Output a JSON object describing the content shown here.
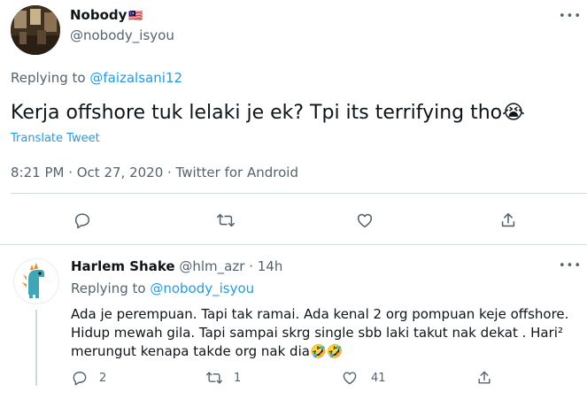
{
  "main_tweet": {
    "display_name": "Nobody",
    "flag_emoji": "🇲🇾",
    "handle": "@nobody_isyou",
    "replying_prefix": "Replying to ",
    "replying_to": "@faizalsani12",
    "text": "Kerja offshore tuk lelaki je ek? Tpi its terrifying tho",
    "emoji": "😭",
    "translate_label": "Translate Tweet",
    "meta": "8:21 PM · Oct 27, 2020 · Twitter for Android"
  },
  "reply_tweet": {
    "display_name": "Harlem Shake",
    "handle": "@hlm_azr",
    "separator": "·",
    "time": "14h",
    "replying_prefix": "Replying to ",
    "replying_to": "@nobody_isyou",
    "line1": "Ada je perempuan. Tapi tak ramai. Ada kenal 2 org pompuan keje offshore.",
    "line2": "Hidup mewah gila. Tapi sampai skrg single sbb laki takut nak dekat . Hari²",
    "line3": "merungut kenapa takde org nak dia",
    "line3_emoji": "🤣🤣",
    "reply_count": "2",
    "retweet_count": "1",
    "like_count": "41"
  },
  "icons": {
    "more": "more-icon",
    "reply": "reply-icon",
    "retweet": "retweet-icon",
    "like": "like-icon",
    "share": "share-icon"
  },
  "colors": {
    "link": "#1d9bf0",
    "muted": "#536471",
    "text": "#0f1419",
    "divider": "#cfd9de"
  }
}
